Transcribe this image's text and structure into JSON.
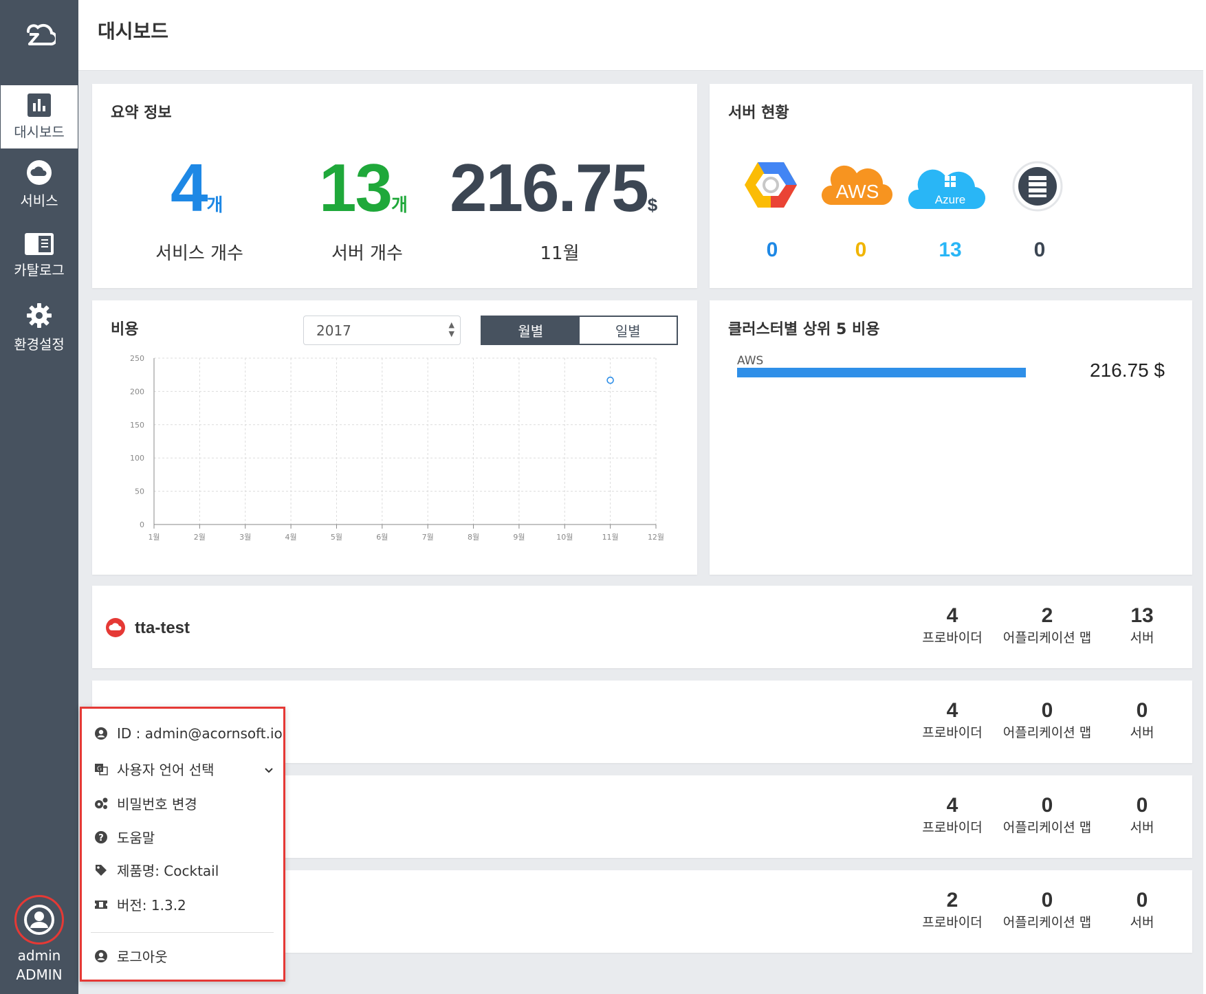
{
  "page": {
    "title": "대시보드"
  },
  "sidebar": {
    "items": [
      {
        "label": "대시보드",
        "icon": "bar-chart-icon",
        "active": true
      },
      {
        "label": "서비스",
        "icon": "cloud-icon"
      },
      {
        "label": "카탈로그",
        "icon": "catalog-icon"
      },
      {
        "label": "환경설정",
        "icon": "gear-icon"
      }
    ],
    "user": {
      "name": "admin",
      "role": "ADMIN"
    }
  },
  "summary": {
    "title": "요약 정보",
    "services": {
      "value": "4",
      "unit": "개",
      "label": "서비스 개수",
      "color": "#1e88e5"
    },
    "servers": {
      "value": "13",
      "unit": "개",
      "label": "서버 개수",
      "color": "#1fa83a"
    },
    "cost": {
      "value": "216.75",
      "unit": "$",
      "label": "11월",
      "color": "#3c4653"
    }
  },
  "server_status": {
    "title": "서버 현황",
    "providers": [
      {
        "name": "google-cloud",
        "count": "0",
        "color": "#1e88e5"
      },
      {
        "name": "AWS",
        "count": "0",
        "color": "#f0b400"
      },
      {
        "name": "Azure",
        "count": "13",
        "color": "#29b6f6"
      },
      {
        "name": "on-premise",
        "count": "0",
        "color": "#3c4653"
      }
    ]
  },
  "cost": {
    "title": "비용",
    "year": "2017",
    "tabs": {
      "monthly": "월별",
      "daily": "일별"
    }
  },
  "chart_data": {
    "type": "scatter",
    "title": "",
    "xlabel": "",
    "ylabel": "",
    "categories": [
      "1월",
      "2월",
      "3월",
      "4월",
      "5월",
      "6월",
      "7월",
      "8월",
      "9월",
      "10월",
      "11월",
      "12월"
    ],
    "series": [
      {
        "x": [
          "11월"
        ],
        "values": [
          216.75
        ]
      }
    ],
    "yticks": [
      "0",
      "50",
      "100",
      "150",
      "200",
      "250"
    ],
    "ylim": [
      0,
      250
    ],
    "grid": true
  },
  "cluster_cost": {
    "title": "클러스터별 상위 5 비용",
    "items": [
      {
        "name": "AWS",
        "value": "216.75 $",
        "fraction": 1.0
      }
    ]
  },
  "services": [
    {
      "name": "tta-test",
      "providers": "4",
      "appmaps": "2",
      "servers": "13"
    },
    {
      "name": "",
      "providers": "4",
      "appmaps": "0",
      "servers": "0"
    },
    {
      "name": "",
      "providers": "4",
      "appmaps": "0",
      "servers": "0"
    },
    {
      "name": "",
      "providers": "2",
      "appmaps": "0",
      "servers": "0"
    }
  ],
  "stat_labels": {
    "providers": "프로바이더",
    "appmaps": "어플리케이션 맵",
    "servers": "서버"
  },
  "user_menu": {
    "id": "ID : admin@acornsoft.io",
    "language": "사용자 언어 선택",
    "password": "비밀번호 변경",
    "help": "도움말",
    "product": "제품명: Cocktail",
    "version": "버전: 1.3.2",
    "logout": "로그아웃"
  }
}
